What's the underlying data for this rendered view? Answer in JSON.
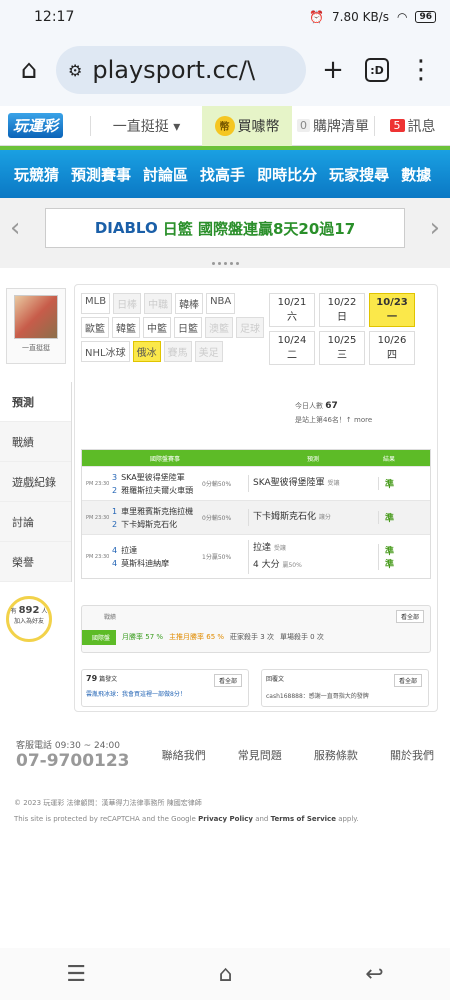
{
  "status": {
    "time": "12:17",
    "net": "7.80 KB/s",
    "battery": "96"
  },
  "browser": {
    "url": "playsport.cc/\\",
    "tab_count": ":D"
  },
  "topnav": {
    "logo": "玩運彩",
    "user": "一直挺挺 ▾",
    "coin": "買噱幣",
    "cart_count": "0",
    "cart": "購牌清單",
    "msg_count": "5",
    "msg": "訊息"
  },
  "mainnav": [
    "玩競猜",
    "預測賽事",
    "討論區",
    "找高手",
    "即時比分",
    "玩家搜尋",
    "數據"
  ],
  "banner": {
    "part1": "DIABLO",
    "part2": "日籃 國際盤連贏8天20過17"
  },
  "profile": {
    "name": "一直挺挺"
  },
  "sidetabs": [
    "預測",
    "戰績",
    "遊戲紀錄",
    "討論",
    "榮譽"
  ],
  "fans": {
    "pre": "有",
    "count": "892",
    "post": "人",
    "sub": "加入為好友"
  },
  "sports": [
    {
      "l": "MLB",
      "s": ""
    },
    {
      "l": "日棒",
      "s": "dim"
    },
    {
      "l": "中職",
      "s": "dim"
    },
    {
      "l": "韓棒",
      "s": ""
    },
    {
      "l": "NBA",
      "s": ""
    },
    {
      "l": "歐籃",
      "s": ""
    },
    {
      "l": "韓籃",
      "s": ""
    },
    {
      "l": "中籃",
      "s": ""
    },
    {
      "l": "日籃",
      "s": ""
    },
    {
      "l": "澳籃",
      "s": "dim"
    },
    {
      "l": "足球",
      "s": "dim"
    },
    {
      "l": "NHL冰球",
      "s": ""
    },
    {
      "l": "俄冰",
      "s": "sel"
    },
    {
      "l": "賽馬",
      "s": "dim"
    },
    {
      "l": "美足",
      "s": "dim"
    }
  ],
  "dates": [
    {
      "l": "10/21 六",
      "s": ""
    },
    {
      "l": "10/22 日",
      "s": ""
    },
    {
      "l": "10/23 一",
      "s": "sel"
    },
    {
      "l": "10/24 二",
      "s": ""
    },
    {
      "l": "10/25 三",
      "s": ""
    },
    {
      "l": "10/26 四",
      "s": ""
    }
  ],
  "today": {
    "label": "今日人數",
    "count": "67",
    "rank": "是站上第46名！↑ more"
  },
  "games_header": {
    "c1": "國際盤賽事",
    "c2": "預測",
    "c3": "結果"
  },
  "games": [
    {
      "time": "PM 23:30",
      "n1": "3",
      "t1": "SKA聖彼得堡陸軍",
      "n2": "2",
      "t2": "雅羅斯拉夫爾火車頭",
      "odds": "0分輸50%",
      "pick": "SKA聖彼得堡陸軍",
      "note": "受讓",
      "res": "準"
    },
    {
      "time": "PM 23:30",
      "n1": "1",
      "t1": "車里雅賓斯克拖拉機",
      "n2": "2",
      "t2": "下卡姆斯克石化",
      "odds": "0分輸50%",
      "pick": "下卡姆斯克石化",
      "note": "讓分",
      "res": "準"
    },
    {
      "time": "PM 23:30",
      "n1": "4",
      "t1": "拉達",
      "n2": "4",
      "t2": "莫斯科迪納摩",
      "odds": "1分贏50%",
      "pick": "拉達",
      "note": "受讓",
      "res": "準",
      "pick2": "4 大分",
      "note2": "贏50%",
      "res2": "準"
    }
  ],
  "stats": {
    "title": "戰績",
    "more": "看全部",
    "label": "國際盤",
    "v1": "月勝率 57 %",
    "v2": "主推月勝率 65 %",
    "v3": "莊家殺手 3 次",
    "v4": "單場殺手 0 次"
  },
  "lower": {
    "l_count": "79",
    "l_title": "篇發文",
    "l_more": "看全部",
    "l_item": "雲胤飛冰球：我會買這裡一部做8分！",
    "l_badge": "3",
    "r_title": "回覆文",
    "r_more": "看全部",
    "r_item": "cash168888：感謝一直哥指大的發牌"
  },
  "footer": {
    "phone_time": "客服電話 09:30 ~ 24:00",
    "phone": "07-9700123",
    "links": [
      "聯絡我們",
      "常見問題",
      "服務條款",
      "關於我們"
    ],
    "copy": "© 2023 玩運彩 法律顧問：漢華得力法律事務所 陳國宏律師",
    "recaptcha_pre": "This site is protected by reCAPTCHA and the Google",
    "pp": "Privacy Policy",
    "and": "and",
    "tos": "Terms of Service",
    "apply": "apply."
  },
  "colors": {
    "accent": "#0b78c4",
    "green": "#5dbb27",
    "highlight": "#fbe84a"
  }
}
